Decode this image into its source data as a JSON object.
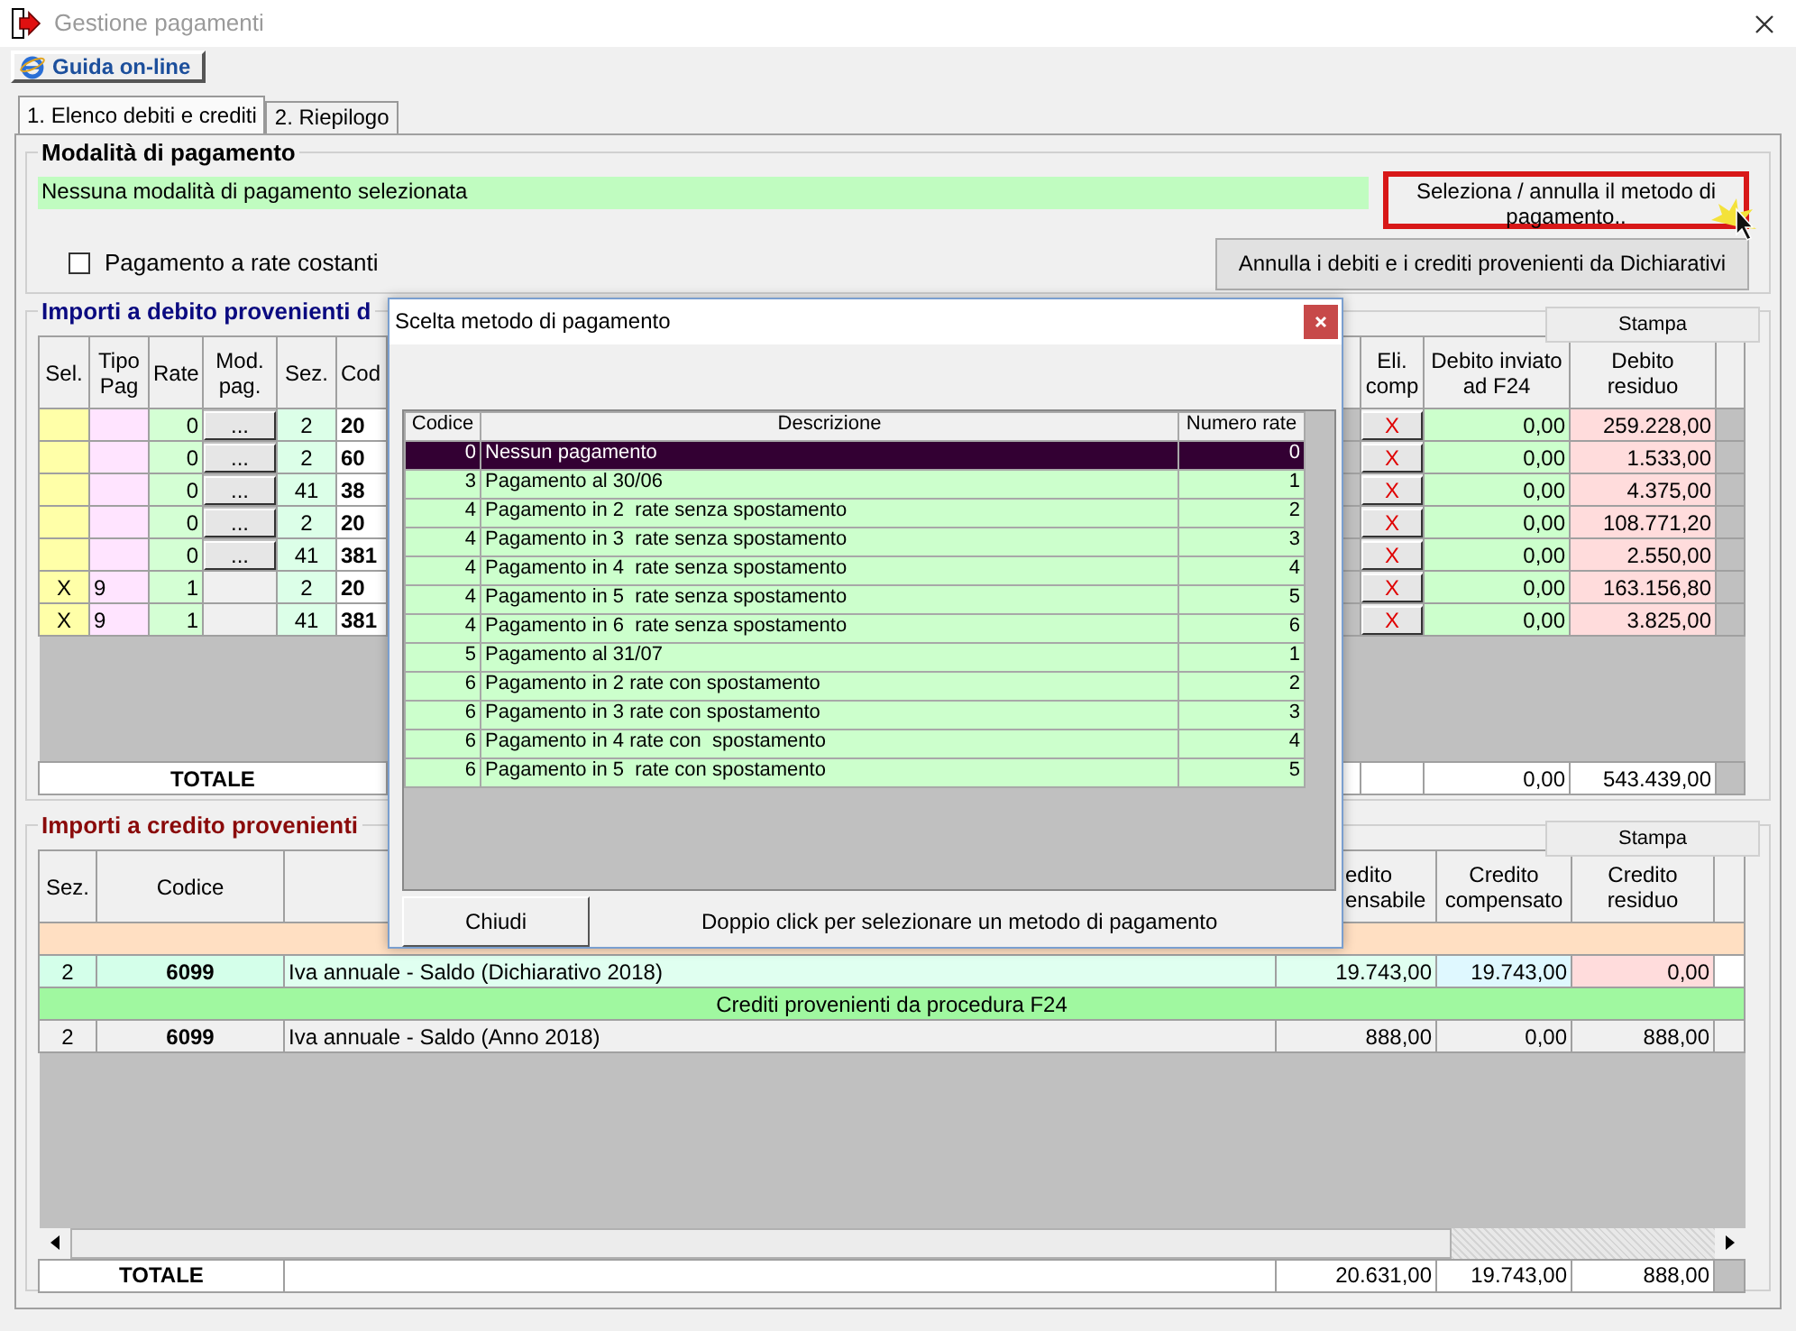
{
  "window": {
    "title": "Gestione pagamenti"
  },
  "help_button": "Guida on-line",
  "tabs": [
    {
      "label": "1. Elenco debiti e crediti",
      "selected": true
    },
    {
      "label": "2. Riepilogo",
      "selected": false
    }
  ],
  "payment_mode": {
    "legend": "Modalità di pagamento",
    "status": "Nessuna modalità di pagamento selezionata",
    "select_button": "Seleziona / annulla il metodo di pagamento..",
    "highlighted": true,
    "installments_checkbox": {
      "label": "Pagamento a rate costanti",
      "checked": false
    },
    "cancel_button": "Annulla i debiti e i crediti provenienti da Dichiarativi"
  },
  "debits": {
    "legend": "Importi a debito provenienti d",
    "print_button": "Stampa",
    "left_columns": [
      "Sel.",
      "Tipo Pag",
      "Rate",
      "Mod. pag.",
      "Sez.",
      "Cod"
    ],
    "right_columns": [
      "Eli. comp",
      "Debito inviato ad F24",
      "Debito residuo"
    ],
    "rows": [
      {
        "rate": "0",
        "mod": "...",
        "sez": "2",
        "cod": "20",
        "eli": "X",
        "inviato": "0,00",
        "residuo": "259.228,00"
      },
      {
        "rate": "0",
        "mod": "...",
        "sez": "2",
        "cod": "60",
        "eli": "X",
        "inviato": "0,00",
        "residuo": "1.533,00"
      },
      {
        "rate": "0",
        "mod": "...",
        "sez": "41",
        "cod": "38",
        "eli": "X",
        "inviato": "0,00",
        "residuo": "4.375,00"
      },
      {
        "rate": "0",
        "mod": "...",
        "sez": "2",
        "cod": "20",
        "eli": "X",
        "inviato": "0,00",
        "residuo": "108.771,20"
      },
      {
        "rate": "0",
        "mod": "...",
        "sez": "41",
        "cod": "381",
        "eli": "X",
        "inviato": "0,00",
        "residuo": "2.550,00"
      },
      {
        "sel": "X",
        "tipo": "9",
        "rate": "1",
        "sez": "2",
        "cod": "20",
        "eli": "X",
        "inviato": "0,00",
        "residuo": "163.156,80"
      },
      {
        "sel": "X",
        "tipo": "9",
        "rate": "1",
        "sez": "41",
        "cod": "381",
        "eli": "X",
        "inviato": "0,00",
        "residuo": "3.825,00"
      }
    ],
    "total": {
      "label": "TOTALE",
      "inviato": "0,00",
      "residuo": "543.439,00"
    }
  },
  "credits": {
    "legend": "Importi a credito provenienti",
    "print_button": "Stampa",
    "columns": [
      "Sez.",
      "Codice",
      "edito ensabile",
      "Credito compensato",
      "Credito residuo"
    ],
    "rows": [
      {
        "kind": "band",
        "color": "#ffdfc2"
      },
      {
        "kind": "row",
        "highlighted": true,
        "sez": "2",
        "codice": "6099",
        "descrizione": "Iva annuale - Saldo (Dichiarativo 2018)",
        "compensabile": "19.743,00",
        "compensato": "19.743,00",
        "residuo": "0,00"
      },
      {
        "kind": "band",
        "color": "#a0f8a0",
        "label": "Crediti provenienti da procedura F24"
      },
      {
        "kind": "row",
        "highlighted": false,
        "sez": "2",
        "codice": "6099",
        "descrizione": "Iva annuale - Saldo (Anno 2018)",
        "compensabile": "888,00",
        "compensato": "0,00",
        "residuo": "888,00"
      }
    ],
    "total": {
      "label": "TOTALE",
      "compensabile": "20.631,00",
      "compensato": "19.743,00",
      "residuo": "888,00"
    }
  },
  "dialog": {
    "title": "Scelta metodo di pagamento",
    "columns": [
      "Codice",
      "Descrizione",
      "Numero rate"
    ],
    "rows": [
      {
        "codice": "0",
        "descrizione": "Nessun pagamento",
        "numero_rate": "0",
        "selected": true
      },
      {
        "codice": "3",
        "descrizione": "Pagamento al 30/06",
        "numero_rate": "1",
        "selected": false
      },
      {
        "codice": "4",
        "descrizione": "Pagamento in 2  rate senza spostamento",
        "numero_rate": "2",
        "selected": false
      },
      {
        "codice": "4",
        "descrizione": "Pagamento in 3  rate senza spostamento",
        "numero_rate": "3",
        "selected": false
      },
      {
        "codice": "4",
        "descrizione": "Pagamento in 4  rate senza spostamento",
        "numero_rate": "4",
        "selected": false
      },
      {
        "codice": "4",
        "descrizione": "Pagamento in 5  rate senza spostamento",
        "numero_rate": "5",
        "selected": false
      },
      {
        "codice": "4",
        "descrizione": "Pagamento in 6  rate senza spostamento",
        "numero_rate": "6",
        "selected": false
      },
      {
        "codice": "5",
        "descrizione": "Pagamento al 31/07",
        "numero_rate": "1",
        "selected": false
      },
      {
        "codice": "6",
        "descrizione": "Pagamento in 2 rate con spostamento",
        "numero_rate": "2",
        "selected": false
      },
      {
        "codice": "6",
        "descrizione": "Pagamento in 3 rate con spostamento",
        "numero_rate": "3",
        "selected": false
      },
      {
        "codice": "6",
        "descrizione": "Pagamento in 4 rate con  spostamento",
        "numero_rate": "4",
        "selected": false
      },
      {
        "codice": "6",
        "descrizione": "Pagamento in 5  rate con spostamento",
        "numero_rate": "5",
        "selected": false
      }
    ],
    "close_button": "Chiudi",
    "hint": "Doppio click per selezionare un metodo di pagamento"
  }
}
